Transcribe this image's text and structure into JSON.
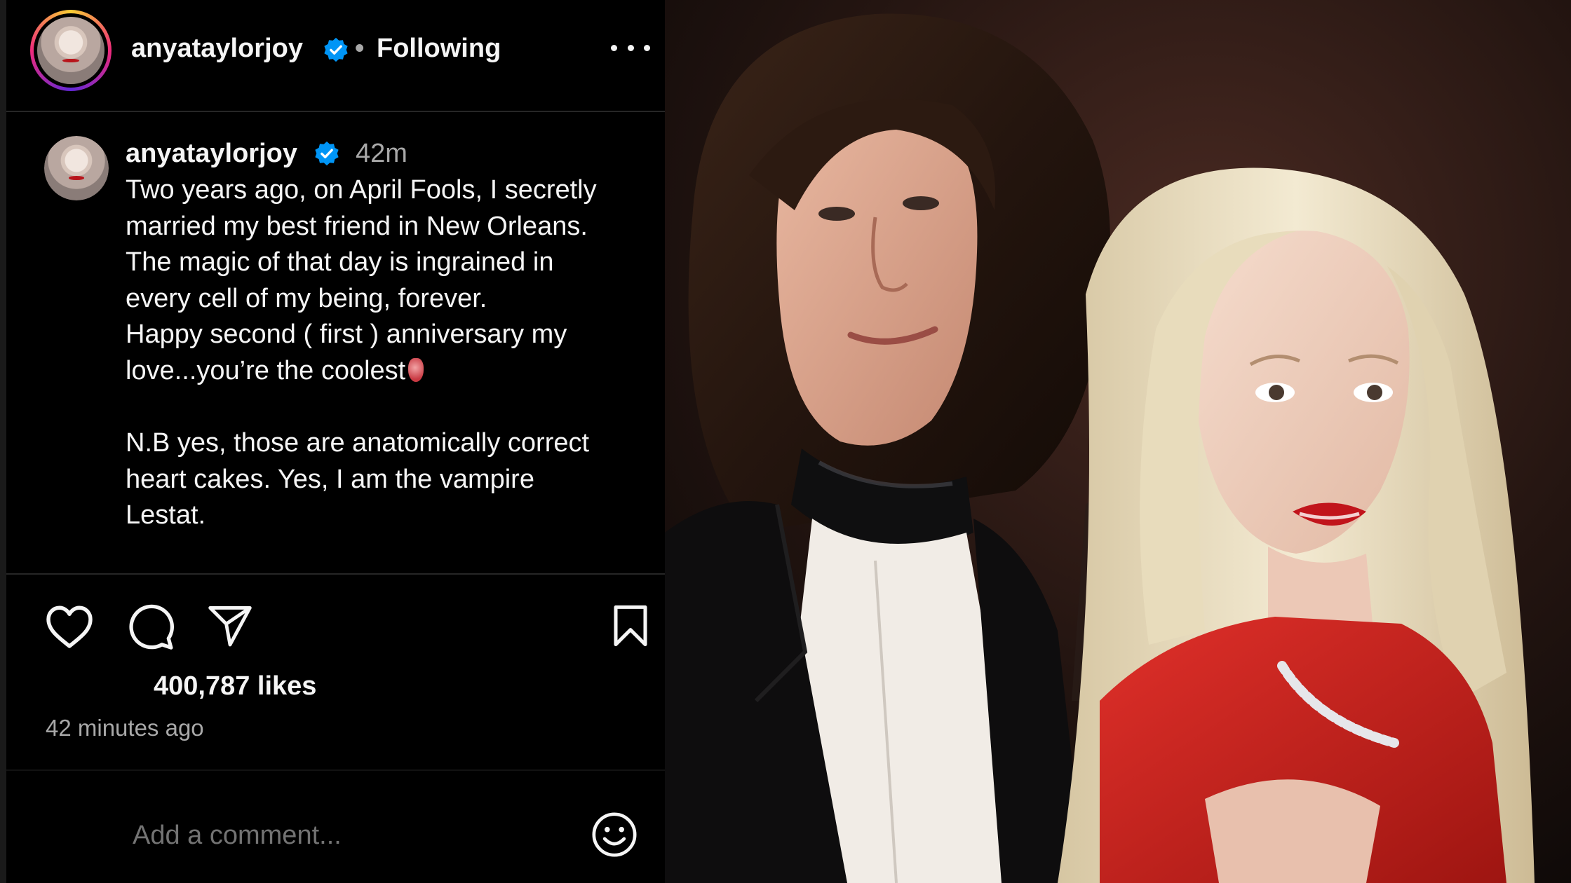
{
  "post": {
    "header": {
      "username": "anyataylorjoy",
      "separator": "•",
      "follow_status": "Following"
    },
    "caption": {
      "username": "anyataylorjoy",
      "time_ago": "42m",
      "text": "Two years ago, on April Fools, I secretly\nmarried my best friend in New Orleans.\nThe magic of that day is ingrained in\nevery cell of my being, forever.\nHappy second ( first ) anniversary my\nlove...you’re the coolest",
      "text_2": "N.B yes, those are anatomically correct\nheart cakes. Yes, I am the vampire\nLestat."
    },
    "likes": "400,787 likes",
    "timestamp": "42 minutes ago",
    "comment_placeholder": "Add a comment..."
  },
  "icons": {
    "verified": "verified-badge-icon",
    "more": "more-options-icon",
    "like": "heart-icon",
    "comment": "comment-bubble-icon",
    "share": "paper-plane-icon",
    "save": "bookmark-icon",
    "emoji": "smiley-icon",
    "caption_emoji": "anatomical-heart-emoji"
  },
  "colors": {
    "background": "#000000",
    "text_primary": "#f5f5f5",
    "text_secondary": "#a8a8a8",
    "placeholder": "#737373",
    "verified_blue": "#0095f6",
    "divider": "#262626"
  }
}
